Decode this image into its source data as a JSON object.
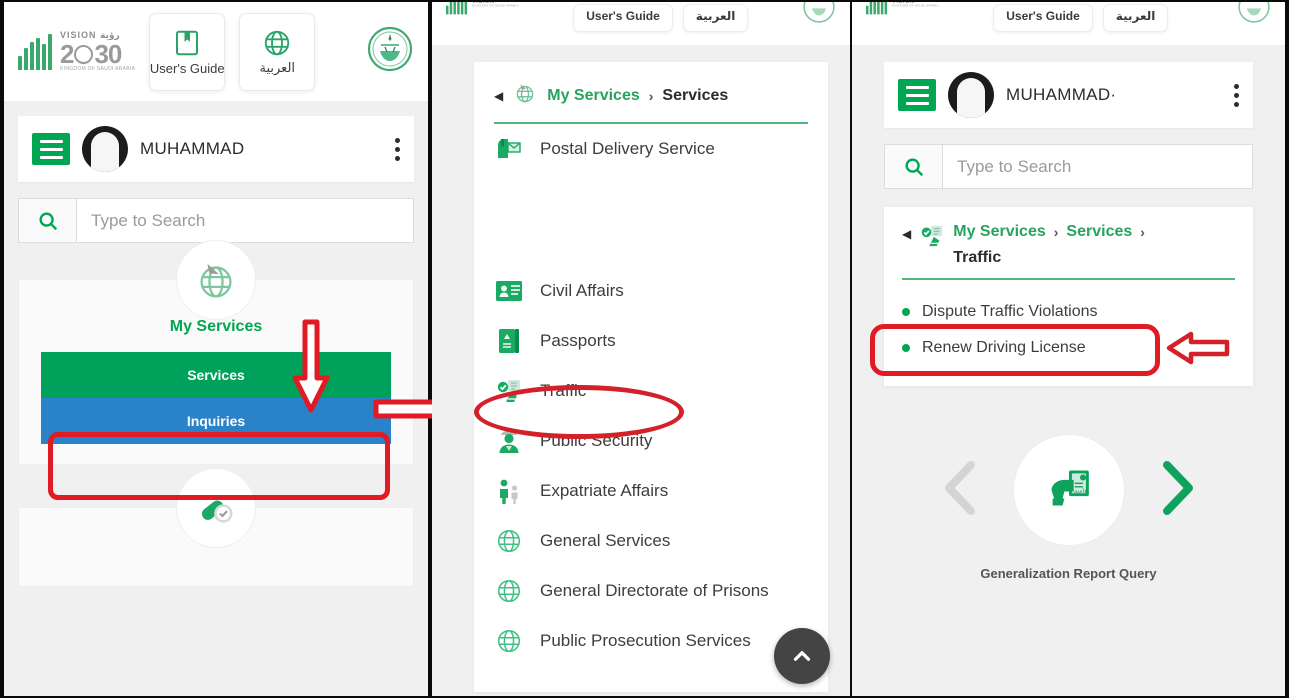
{
  "site_header": {
    "vision_top": "VISION",
    "vision_num": "2 30",
    "vision_sub": "KINGDOM OF SAUDI ARABIA",
    "users_guide": "User's Guide",
    "arabic": "العربية",
    "emblem_name": "moi-emblem"
  },
  "left_panel": {
    "userbar": {
      "username": "MUHAMMAD"
    },
    "search": {
      "placeholder": "Type to Search",
      "value": ""
    },
    "card": {
      "title": "My Services",
      "services_button": "Services",
      "inquiries_button": "Inquiries"
    }
  },
  "mid_panel": {
    "breadcrumb": {
      "root": "My Services",
      "separator": "›",
      "current": "Services"
    },
    "items": [
      {
        "label": "Postal Delivery Service",
        "icon": "mailbox-icon"
      },
      {
        "label": "Civil Affairs",
        "icon": "id-card-icon"
      },
      {
        "label": "Passports",
        "icon": "passport-icon"
      },
      {
        "label": "Traffic",
        "icon": "traffic-icon"
      },
      {
        "label": "Public Security",
        "icon": "officer-icon"
      },
      {
        "label": "Expatriate Affairs",
        "icon": "family-icon"
      },
      {
        "label": "General Services",
        "icon": "globe-icon"
      },
      {
        "label": "General Directorate of Prisons",
        "icon": "globe-icon"
      },
      {
        "label": "Public Prosecution Services",
        "icon": "globe-icon"
      }
    ],
    "scroll_top_label": "scroll-to-top"
  },
  "right_panel": {
    "userbar": {
      "username": "MUHAMMAD·"
    },
    "search": {
      "placeholder": "Type to Search",
      "value": ""
    },
    "breadcrumb": {
      "root": "My Services",
      "second": "Services",
      "separator": "›",
      "current": "Traffic"
    },
    "items": [
      {
        "label": "Dispute Traffic Violations"
      },
      {
        "label": "Renew Driving License"
      }
    ],
    "carousel": {
      "caption": "Generalization Report Query",
      "prev": "carousel-prev",
      "next": "carousel-next"
    }
  },
  "colors": {
    "brand_green": "#00a651",
    "button_green": "#00a15a",
    "button_blue": "#2a82c9",
    "annotation_red": "#e01b24",
    "text_dark": "#3d3d3d"
  }
}
